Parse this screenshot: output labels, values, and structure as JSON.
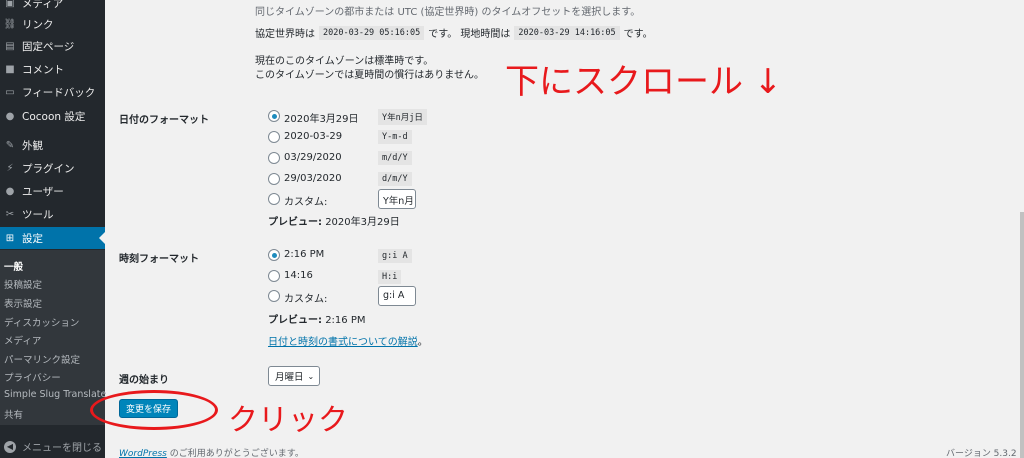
{
  "sidebar": {
    "items": [
      {
        "label": "メディア",
        "icon": "media-icon",
        "glyph": "▣"
      },
      {
        "label": "リンク",
        "icon": "link-icon",
        "glyph": "⛓"
      },
      {
        "label": "固定ページ",
        "icon": "page-icon",
        "glyph": "▤"
      },
      {
        "label": "コメント",
        "icon": "comment-icon",
        "glyph": "■"
      },
      {
        "label": "フィードバック",
        "icon": "feedback-icon",
        "glyph": "▭"
      },
      {
        "label": "Cocoon 設定",
        "icon": "cocoon-icon",
        "glyph": "●"
      },
      {
        "label": "外観",
        "icon": "appearance-icon",
        "glyph": "✎"
      },
      {
        "label": "プラグイン",
        "icon": "plugin-icon",
        "glyph": "⚡"
      },
      {
        "label": "ユーザー",
        "icon": "user-icon",
        "glyph": "●"
      },
      {
        "label": "ツール",
        "icon": "tool-icon",
        "glyph": "✂"
      },
      {
        "label": "設定",
        "icon": "settings-icon",
        "glyph": "⊞"
      }
    ],
    "submenu": [
      "一般",
      "投稿設定",
      "表示設定",
      "ディスカッション",
      "メディア",
      "パーマリンク設定",
      "プライバシー",
      "Simple Slug Translate",
      "共有"
    ],
    "collapse_label": "メニューを閉じる"
  },
  "timezone": {
    "help": "同じタイムゾーンの都市または UTC (協定世界時) のタイムオフセットを選択します。",
    "utc_label": "協定世界時は",
    "utc_value": "2020-03-29 05:16:05",
    "utc_suffix": "です。 現地時間は",
    "local_value": "2020-03-29 14:16:05",
    "local_suffix": "です。",
    "note1": "現在のこのタイムゾーンは標準時です。",
    "note2": "このタイムゾーンでは夏時間の慣行はありません。"
  },
  "date_format": {
    "label": "日付のフォーマット",
    "options": [
      {
        "text": "2020年3月29日",
        "code": "Y年n月j日",
        "checked": true
      },
      {
        "text": "2020-03-29",
        "code": "Y-m-d",
        "checked": false
      },
      {
        "text": "03/29/2020",
        "code": "m/d/Y",
        "checked": false
      },
      {
        "text": "29/03/2020",
        "code": "d/m/Y",
        "checked": false
      }
    ],
    "custom_label": "カスタム:",
    "custom_value": "Y年n月",
    "preview_label": "プレビュー:",
    "preview_value": "2020年3月29日"
  },
  "time_format": {
    "label": "時刻フォーマット",
    "options": [
      {
        "text": "2:16 PM",
        "code": "g:i A",
        "checked": true
      },
      {
        "text": "14:16",
        "code": "H:i",
        "checked": false
      }
    ],
    "custom_label": "カスタム:",
    "custom_value": "g:i A",
    "preview_label": "プレビュー:",
    "preview_value": "2:16 PM",
    "doc_link": "日付と時刻の書式についての解説",
    "doc_link_suffix": "。"
  },
  "week_start": {
    "label": "週の始まり",
    "value": "月曜日"
  },
  "save_label": "変更を保存",
  "annotations": {
    "scroll": "下にスクロール ↓",
    "click": "クリック"
  },
  "footer": {
    "wp_link": "WordPress",
    "thanks": " のご利用ありがとうございます。",
    "version": "バージョン 5.3.2"
  },
  "colors": {
    "sidebar_bg": "#23282d",
    "active": "#0073aa",
    "annotation_red": "#e8191c",
    "button_blue": "#0085ba"
  }
}
